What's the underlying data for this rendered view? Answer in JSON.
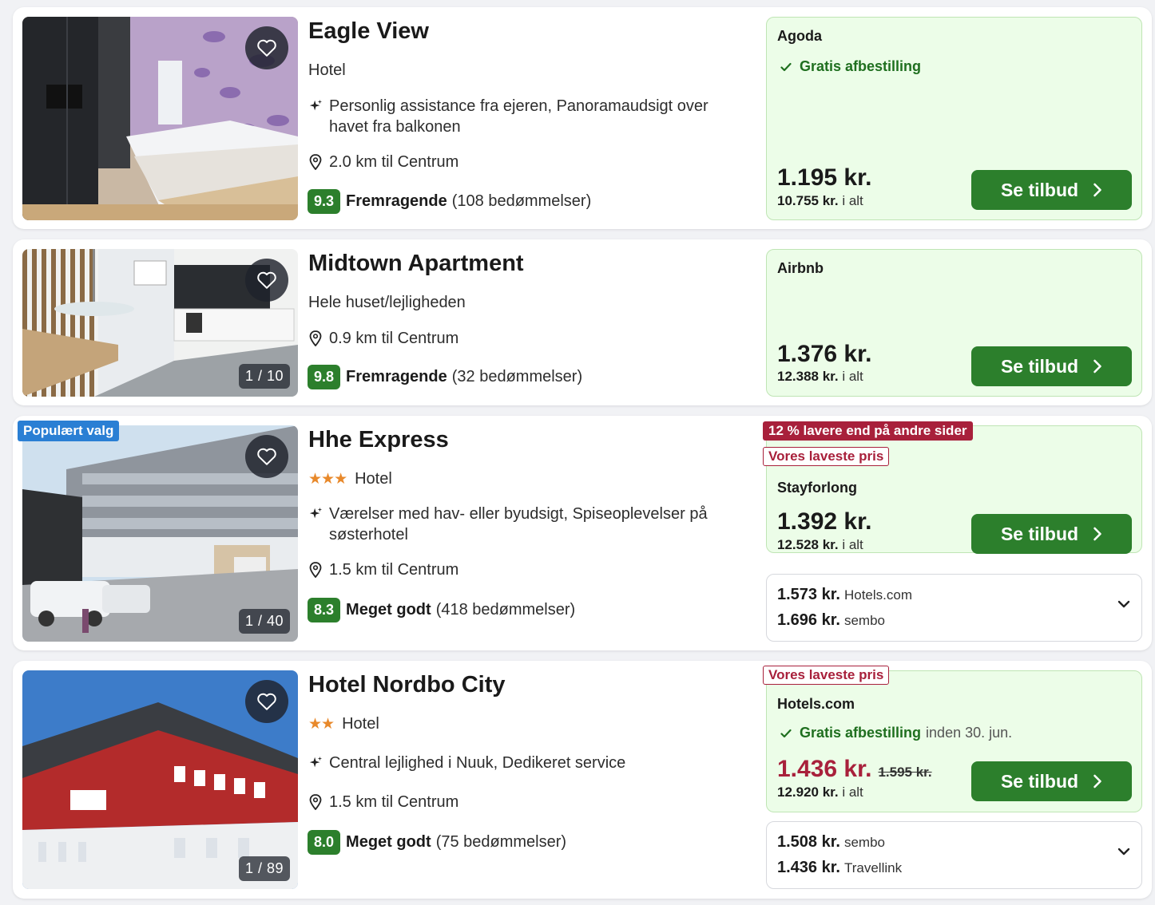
{
  "colors": {
    "accent_green": "#2c7f2c",
    "offer_bg": "#ecfde8",
    "deal_red": "#a8203b",
    "popular_blue": "#2a7fd4",
    "star_orange": "#e8892b"
  },
  "listings": [
    {
      "name": "Eagle View",
      "type": "Hotel",
      "stars": "",
      "amenities": "Personlig assistance fra ejeren, Panoramaudsigt over havet fra balkonen",
      "distance": "2.0 km til Centrum",
      "score": "9.3",
      "rating_label": "Fremragende",
      "reviews": "(108 bedømmelser)",
      "photo_counter": "",
      "provider": "Agoda",
      "gratis_label": "Gratis afbestilling",
      "price": "1.195 kr.",
      "total_price": "10.755 kr.",
      "total_suffix": "i alt",
      "cta_label": "Se tilbud"
    },
    {
      "name": "Midtown Apartment",
      "type": "Hele huset/lejligheden",
      "distance": "0.9 km til Centrum",
      "score": "9.8",
      "rating_label": "Fremragende",
      "reviews": "(32 bedømmelser)",
      "photo_counter": "1 / 10",
      "provider": "Airbnb",
      "price": "1.376 kr.",
      "total_price": "12.388 kr.",
      "total_suffix": "i alt",
      "cta_label": "Se tilbud"
    },
    {
      "name": "Hhe Express",
      "type": "Hotel",
      "stars": "★★★",
      "popular_badge": "Populært valg",
      "amenities": "Værelser med hav- eller byudsigt, Spiseoplevelser på søsterhotel",
      "distance": "1.5 km til Centrum",
      "score": "8.3",
      "rating_label": "Meget godt",
      "reviews": "(418 bedømmelser)",
      "photo_counter": "1 / 40",
      "deal_badge": "12 % lavere end på andre sider",
      "lowest_badge": "Vores laveste pris",
      "provider": "Stayforlong",
      "price": "1.392 kr.",
      "total_price": "12.528 kr.",
      "total_suffix": "i alt",
      "cta_label": "Se tilbud",
      "other_offers": [
        {
          "price": "1.573 kr.",
          "site": "Hotels.com"
        },
        {
          "price": "1.696 kr.",
          "site": "sembo"
        }
      ]
    },
    {
      "name": "Hotel Nordbo City",
      "type": "Hotel",
      "stars": "★★",
      "amenities": "Central lejlighed i Nuuk, Dedikeret service",
      "distance": "1.5 km til Centrum",
      "score": "8.0",
      "rating_label": "Meget godt",
      "reviews": "(75 bedømmelser)",
      "photo_counter": "1 / 89",
      "lowest_badge": "Vores laveste pris",
      "provider": "Hotels.com",
      "gratis_label": "Gratis afbestilling",
      "gratis_extra": "inden 30. jun.",
      "price": "1.436 kr.",
      "old_price": "1.595 kr.",
      "total_price": "12.920 kr.",
      "total_suffix": "i alt",
      "cta_label": "Se tilbud",
      "other_offers": [
        {
          "price": "1.508 kr.",
          "site": "sembo"
        },
        {
          "price": "1.436 kr.",
          "site": "Travellink"
        }
      ]
    }
  ]
}
